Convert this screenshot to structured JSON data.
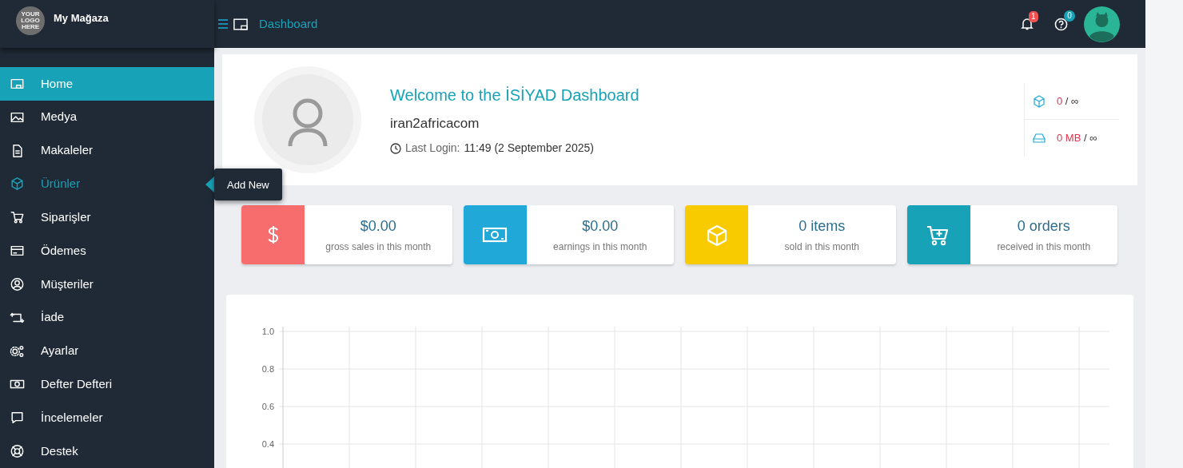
{
  "brand": {
    "logo_text": "YOUR LOGO HERE",
    "name": "My Mağaza"
  },
  "header": {
    "title": "Dashboard",
    "notifications": {
      "count": "1"
    },
    "help": {
      "count": "0"
    }
  },
  "sidebar": {
    "items": [
      {
        "label": "Home",
        "selected": true,
        "hovered": false
      },
      {
        "label": "Medya",
        "selected": false,
        "hovered": false
      },
      {
        "label": "Makaleler",
        "selected": false,
        "hovered": false
      },
      {
        "label": "Ürünler",
        "selected": false,
        "hovered": true
      },
      {
        "label": "Siparişler",
        "selected": false,
        "hovered": false
      },
      {
        "label": "Ödemes",
        "selected": false,
        "hovered": false
      },
      {
        "label": "Müşteriler",
        "selected": false,
        "hovered": false
      },
      {
        "label": "İade",
        "selected": false,
        "hovered": false
      },
      {
        "label": "Ayarlar",
        "selected": false,
        "hovered": false
      },
      {
        "label": "Defter Defteri",
        "selected": false,
        "hovered": false
      },
      {
        "label": "İncelemeler",
        "selected": false,
        "hovered": false
      },
      {
        "label": "Destek",
        "selected": false,
        "hovered": false
      }
    ]
  },
  "tooltip": {
    "text": "Add New"
  },
  "welcome": {
    "title": "Welcome to the İSİYAD Dashboard",
    "username": "iran2africacom",
    "last_login_label": "Last Login:",
    "last_login_value": "11:49 (2 September 2025)"
  },
  "usage": [
    {
      "used": "0",
      "separator": "/",
      "limit": "∞"
    },
    {
      "used": "0 MB",
      "separator": "/",
      "limit": "∞"
    }
  ],
  "stats": [
    {
      "value": "$0.00",
      "caption": "gross sales in this month",
      "color": "#f76d6d"
    },
    {
      "value": "$0.00",
      "caption": "earnings in this month",
      "color": "#20a8d8"
    },
    {
      "value": "0 items",
      "caption": "sold in this month",
      "color": "#f8cb00"
    },
    {
      "value": "0 orders",
      "caption": "received in this month",
      "color": "#17a2b8"
    }
  ],
  "chart": {
    "y_axis_labels": [
      "1.0",
      "0.8",
      "0.6",
      "0.4"
    ]
  }
}
